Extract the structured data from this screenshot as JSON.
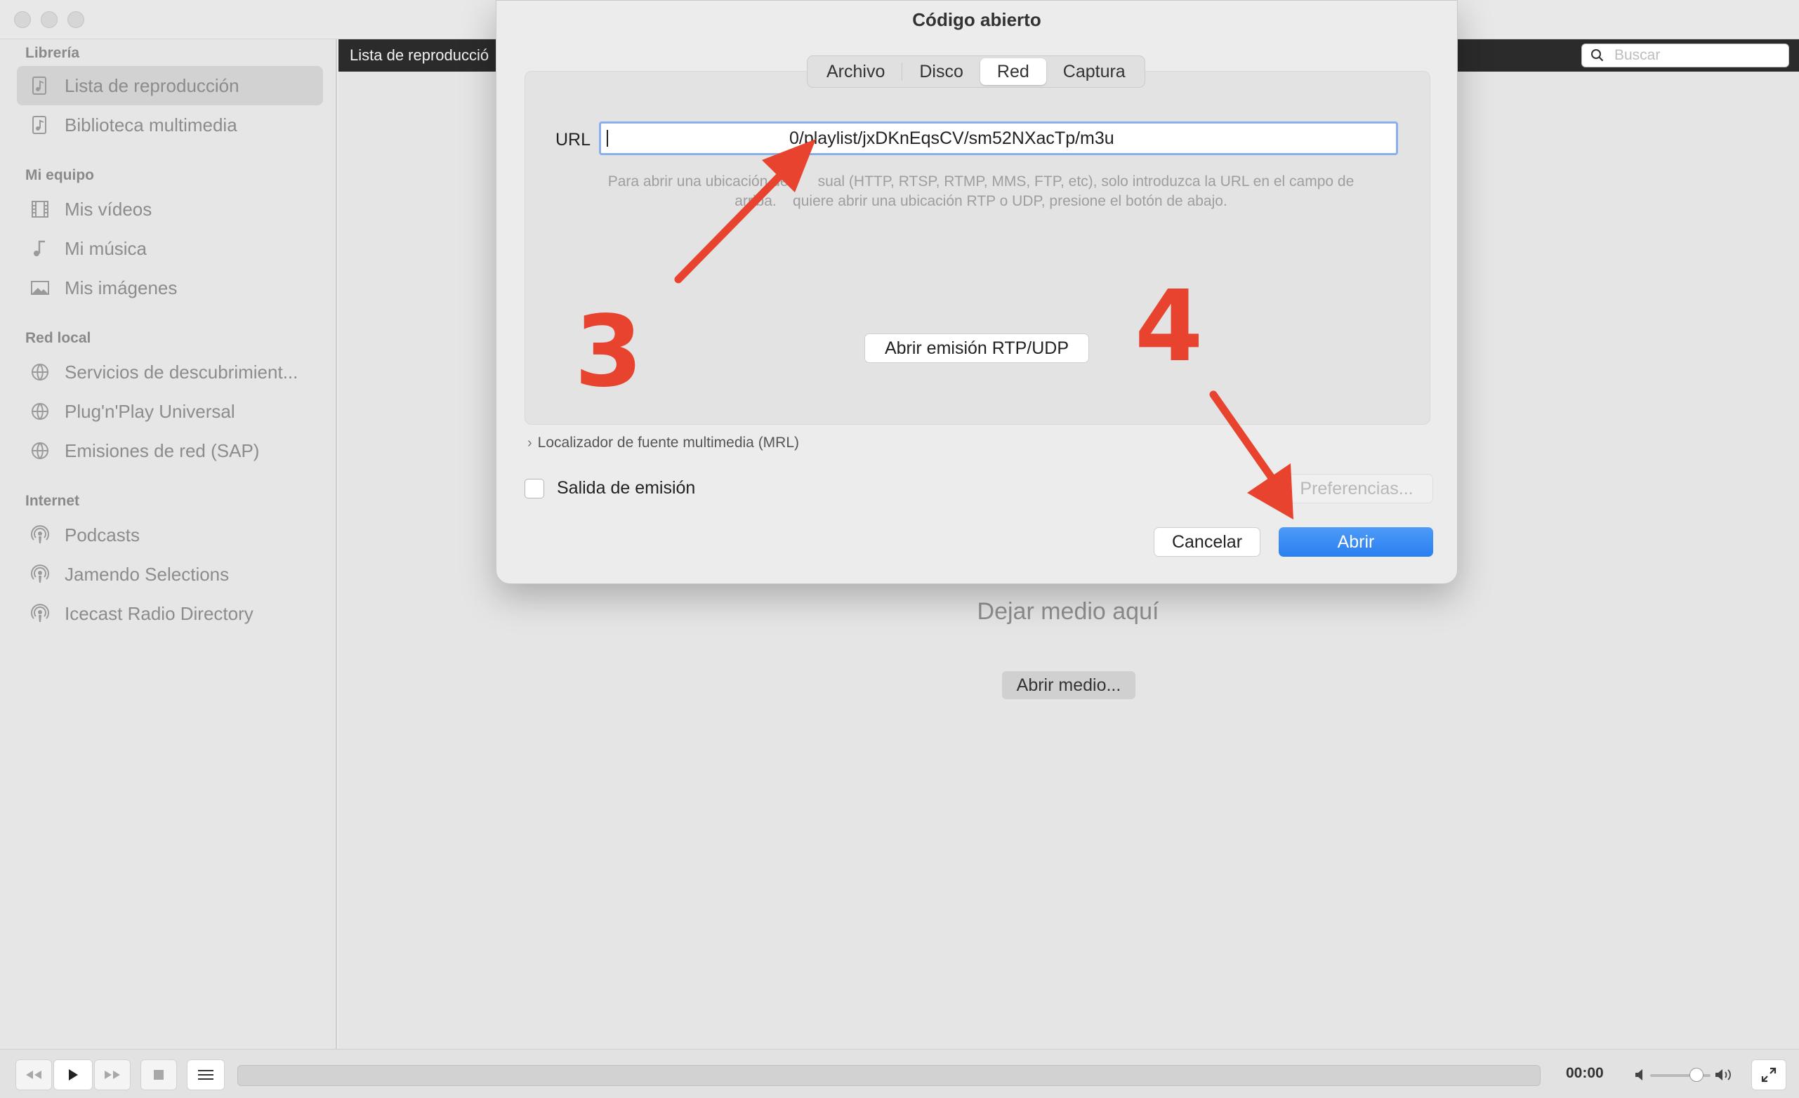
{
  "sidebar": {
    "sections": [
      {
        "title": "Librería",
        "items": [
          {
            "label": "Lista de reproducción",
            "icon": "playlist-icon",
            "selected": true
          },
          {
            "label": "Biblioteca multimedia",
            "icon": "media-library-icon"
          }
        ]
      },
      {
        "title": "Mi equipo",
        "items": [
          {
            "label": "Mis vídeos",
            "icon": "film-icon"
          },
          {
            "label": "Mi música",
            "icon": "music-note-icon"
          },
          {
            "label": "Mis imágenes",
            "icon": "image-icon"
          }
        ]
      },
      {
        "title": "Red local",
        "items": [
          {
            "label": "Servicios de descubrimient...",
            "icon": "network-globe-icon"
          },
          {
            "label": "Plug'n'Play Universal",
            "icon": "network-globe-icon"
          },
          {
            "label": "Emisiones de red (SAP)",
            "icon": "network-globe-icon"
          }
        ]
      },
      {
        "title": "Internet",
        "items": [
          {
            "label": "Podcasts",
            "icon": "podcast-icon"
          },
          {
            "label": "Jamendo Selections",
            "icon": "podcast-icon"
          },
          {
            "label": "Icecast Radio Directory",
            "icon": "podcast-icon"
          }
        ]
      }
    ]
  },
  "header": {
    "title": "Lista de reproducció"
  },
  "search": {
    "placeholder": "Buscar"
  },
  "main": {
    "drop_label": "Dejar medio aquí",
    "open_media_label": "Abrir medio..."
  },
  "controls": {
    "time": "00:00",
    "volume_level": 0.75,
    "progress": 0
  },
  "dialog": {
    "title": "Código abierto",
    "tabs": [
      {
        "label": "Archivo"
      },
      {
        "label": "Disco"
      },
      {
        "label": "Red",
        "active": true
      },
      {
        "label": "Captura"
      }
    ],
    "url_label": "URL",
    "url_value": "0/playlist/jxDKnEqsCV/sm52NXacTp/m3u",
    "help_text_line1": "Para abrir una ubicación de r     sual (HTTP, RTSP, RTMP, MMS, FTP, etc), solo introduzca la URL en el campo de",
    "help_text_line2": "arriba.    quiere abrir una ubicación RTP o UDP, presione el botón de abajo.",
    "rtp_button": "Abrir emisión RTP/UDP",
    "mrl_label": "Localizador de fuente multimedia (MRL)",
    "stream_output_label": "Salida de emisión",
    "preferences_button": "Preferencias...",
    "cancel_button": "Cancelar",
    "open_button": "Abrir"
  },
  "annotations": {
    "step3": "3",
    "step4": "4",
    "color": "#e8432f"
  }
}
